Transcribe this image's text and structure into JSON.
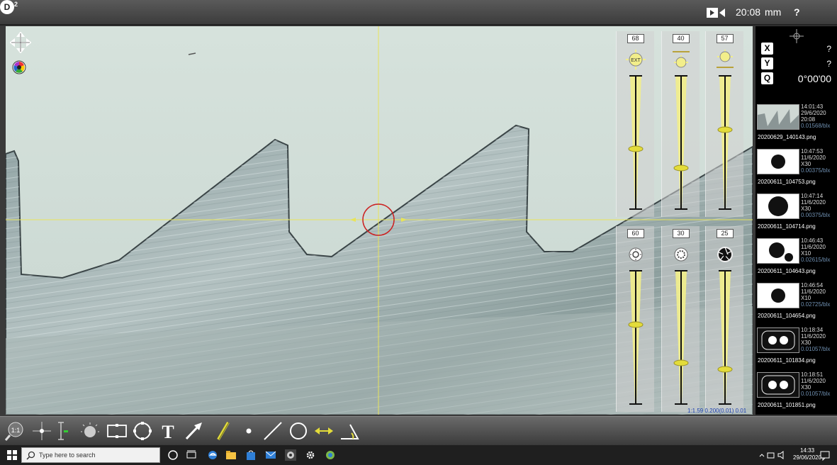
{
  "topbar": {
    "clock": "20:08",
    "unit": "mm",
    "help": "?",
    "zoom_badge": "D",
    "zoom_sup": "2"
  },
  "viewport": {
    "scale_readout": "1:1.59 0.200(0.01) 0.01"
  },
  "sliders_top": [
    {
      "value": "68",
      "icon": "ext-light-icon",
      "level": 0.45
    },
    {
      "value": "40",
      "icon": "top-light-icon",
      "level": 0.3
    },
    {
      "value": "57",
      "icon": "ring-light-icon",
      "level": 0.6
    }
  ],
  "sliders_bottom": [
    {
      "value": "60",
      "icon": "brightness-icon",
      "level": 0.6
    },
    {
      "value": "30",
      "icon": "contrast-icon",
      "level": 0.3
    },
    {
      "value": "25",
      "icon": "aperture-icon",
      "level": 0.25
    }
  ],
  "sidebar": {
    "x_label": "X",
    "x_value": "?",
    "y_label": "Y",
    "y_value": "?",
    "q_label": "Q",
    "q_value": "0°00'00",
    "thumbnails": [
      {
        "time": "14:01:43",
        "date": "29/6/2020",
        "zoom": "20:08",
        "scale": "0.01568/blx",
        "file": "20200629_140143.png",
        "kind": "saw"
      },
      {
        "time": "10:47:53",
        "date": "11/6/2020",
        "zoom": "X30",
        "scale": "0.00375/blx",
        "file": "20200611_104753.png",
        "kind": "dot"
      },
      {
        "time": "10:47:14",
        "date": "11/6/2020",
        "zoom": "X30",
        "scale": "0.00375/blx",
        "file": "20200611_104714.png",
        "kind": "bigdot"
      },
      {
        "time": "10:46:43",
        "date": "11/6/2020",
        "zoom": "X10",
        "scale": "0.02615/blx",
        "file": "20200611_104643.png",
        "kind": "dot2"
      },
      {
        "time": "10:46:54",
        "date": "11/6/2020",
        "zoom": "X10",
        "scale": "0.02725/blx",
        "file": "20200611_104654.png",
        "kind": "dot"
      },
      {
        "time": "10:18:34",
        "date": "11/6/2020",
        "zoom": "X30",
        "scale": "0.01057/blx",
        "file": "20200611_101834.png",
        "kind": "two"
      },
      {
        "time": "10:18:51",
        "date": "11/6/2020",
        "zoom": "X30",
        "scale": "0.01057/blx",
        "file": "20200611_101851.png",
        "kind": "two"
      }
    ]
  },
  "toolbar": [
    {
      "name": "zoom-1to1-tool",
      "label": "1:1"
    },
    {
      "name": "crosshair-tool"
    },
    {
      "name": "vertical-measure-tool"
    },
    {
      "name": "illumination-tool"
    },
    {
      "name": "rectangle-tool"
    },
    {
      "name": "circle-tool"
    },
    {
      "name": "text-tool",
      "label": "T"
    },
    {
      "name": "arrow-tool"
    },
    {
      "name": "pen-tool"
    },
    {
      "name": "point-tool"
    },
    {
      "name": "line-tool"
    },
    {
      "name": "circle-measure-tool"
    },
    {
      "name": "distance-tool"
    },
    {
      "name": "angle-tool"
    }
  ],
  "taskbar": {
    "search_placeholder": "Type here to search",
    "time": "14:33",
    "date": "29/06/2020"
  },
  "colors": {
    "accent": "#f2ee8a",
    "crosshair": "#e8e45a",
    "target": "#cc2222",
    "scale": "#1a3fb0"
  }
}
